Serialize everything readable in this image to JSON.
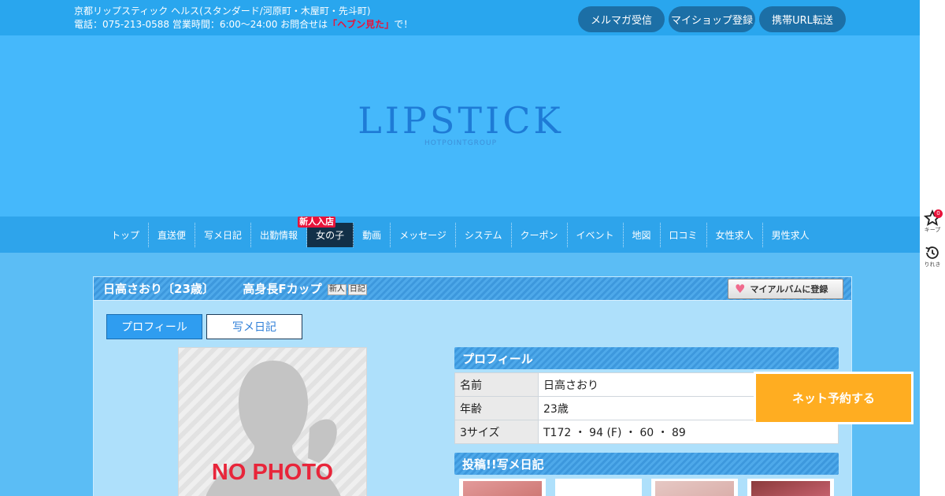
{
  "header": {
    "line1": "京都リップスティック ヘルス(スタンダード/河原町・木屋町・先斗町)",
    "line2_prefix": "電話：075-213-0588 営業時間：6:00～24:00 お問合せは",
    "line2_highlight": "「ヘブン見た」",
    "line2_suffix": "で！",
    "buttons": [
      "メルマガ受信",
      "マイショップ登録",
      "携帯URL転送"
    ]
  },
  "logo": {
    "word": "LIPSTICK",
    "sub": "HOTPOINTGROUP"
  },
  "nav": {
    "items": [
      "トップ",
      "直送便",
      "写メ日記",
      "出勤情報",
      "女の子",
      "動画",
      "メッセージ",
      "システム",
      "クーポン",
      "イベント",
      "地図",
      "口コミ",
      "女性求人",
      "男性求人"
    ],
    "active_index": 4,
    "badge": "新人入店"
  },
  "profile_header": {
    "name": "日高さおり〔23歳〕",
    "catch": "高身長Fカップ",
    "tags": [
      "新人",
      "日記"
    ],
    "album_button": "マイアルバムに登録"
  },
  "tabs": [
    "プロフィール",
    "写メ日記"
  ],
  "photo": {
    "text": "NO PHOTO"
  },
  "profile_section": {
    "heading": "プロフィール",
    "rows": [
      {
        "key": "名前",
        "value": "日高さおり"
      },
      {
        "key": "年齢",
        "value": "23歳"
      },
      {
        "key": "3サイズ",
        "value": "T172 ・ 94 (F) ・ 60 ・ 89"
      }
    ]
  },
  "diary_section": {
    "heading": "投稿!!写メ日記"
  },
  "reserve_button": "ネット予約する",
  "rail": {
    "keep_label": "キープ",
    "keep_count": "0",
    "history_label": "りれき"
  },
  "colors": {
    "accent": "#2ea4eb",
    "hero": "#45b8fb",
    "highlight_red": "#e8133a",
    "reserve": "#ffad21"
  }
}
